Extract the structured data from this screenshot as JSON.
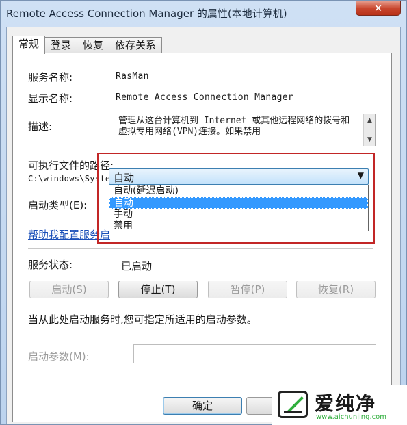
{
  "window": {
    "title": "Remote Access Connection Manager 的属性(本地计算机)",
    "close_label": "✕"
  },
  "tabs": [
    {
      "label": "常规"
    },
    {
      "label": "登录"
    },
    {
      "label": "恢复"
    },
    {
      "label": "依存关系"
    }
  ],
  "general": {
    "service_name_label": "服务名称:",
    "service_name_value": "RasMan",
    "display_name_label": "显示名称:",
    "display_name_value": "Remote Access Connection Manager",
    "description_label": "描述:",
    "description_value": "管理从这台计算机到 Internet 或其他远程网络的拨号和虚拟专用网络(VPN)连接。如果禁用",
    "exe_path_label": "可执行文件的路径:",
    "exe_path_value": "C:\\windows\\System32\\svchost.exe -k netsvcs",
    "startup_type_label": "启动类型(E):",
    "startup_type_value": "自动",
    "startup_options": [
      "自动(延迟启动)",
      "自动",
      "手动",
      "禁用"
    ],
    "help_link": "帮助我配置服务启",
    "service_status_label": "服务状态:",
    "service_status_value": "已启动",
    "hint_text": "当从此处启动服务时,您可指定所适用的启动参数。",
    "start_params_label": "启动参数(M):",
    "start_params_value": ""
  },
  "buttons": {
    "start": "启动(S)",
    "stop": "停止(T)",
    "pause": "暂停(P)",
    "resume": "恢复(R)",
    "ok": "确定"
  },
  "watermark": {
    "name": "爱纯净",
    "url": "www.aichunjing.com"
  },
  "colors": {
    "highlight_border": "#c22626",
    "selected_option": "#3399ff",
    "link": "#1a4fb8"
  }
}
